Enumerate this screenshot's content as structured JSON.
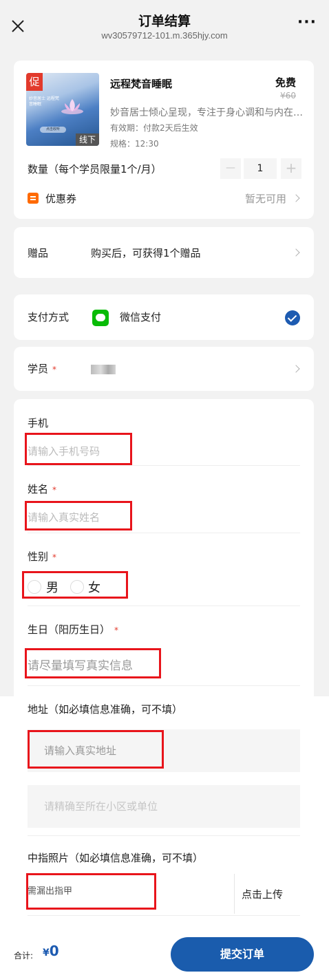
{
  "header": {
    "title": "订单结算",
    "url": "wv30579712-101.m.365hjy.com",
    "more": "···"
  },
  "product": {
    "badge": "促",
    "thumb_caption": "妙音居士 远程梵音睡眠",
    "thumb_button": "点击收听",
    "tag": "线下",
    "name": "远程梵音睡眠",
    "price": "免费",
    "original_price": "¥60",
    "description": "妙音居士倾心呈现，专注于身心调和与内在…",
    "validity": "有效期：付款2天后生效",
    "spec": "规格：12:30",
    "quantity_label": "数量（每个学员限量1个/月）",
    "quantity": "1",
    "minus": "—",
    "plus": "+"
  },
  "coupon": {
    "label": "优惠券",
    "status": "暂无可用"
  },
  "gift": {
    "label": "赠品",
    "text": "购买后，可获得1个赠品"
  },
  "payment": {
    "label": "支付方式",
    "method": "微信支付"
  },
  "student": {
    "label": "学员",
    "required": "*"
  },
  "form": {
    "phone_label": "手机",
    "phone_placeholder": "请输入手机号码",
    "name_label": "姓名",
    "name_placeholder": "请输入真实姓名",
    "gender_label": "性别",
    "gender_options": [
      "男",
      "女"
    ],
    "birthday_label": "生日（阳历生日）",
    "birthday_placeholder": "请尽量填写真实信息",
    "address_label": "地址（如必填信息准确，可不填）",
    "address_placeholder": "请输入真实地址",
    "address_detail_placeholder": "请精确至所在小区或单位",
    "finger_label": "中指照片（如必填信息准确，可不填）",
    "finger_hint": "需漏出指甲",
    "upload_label": "点击上传",
    "required_mark": "*"
  },
  "footer": {
    "total_label": "合计:",
    "currency": "¥",
    "total_value": "0",
    "submit_label": "提交订单"
  },
  "colors": {
    "accent": "#1a5cad",
    "wechat": "#09bb07",
    "highlight_box": "#e8141b",
    "required": "#e23a2c",
    "coupon": "#ff6a00"
  }
}
